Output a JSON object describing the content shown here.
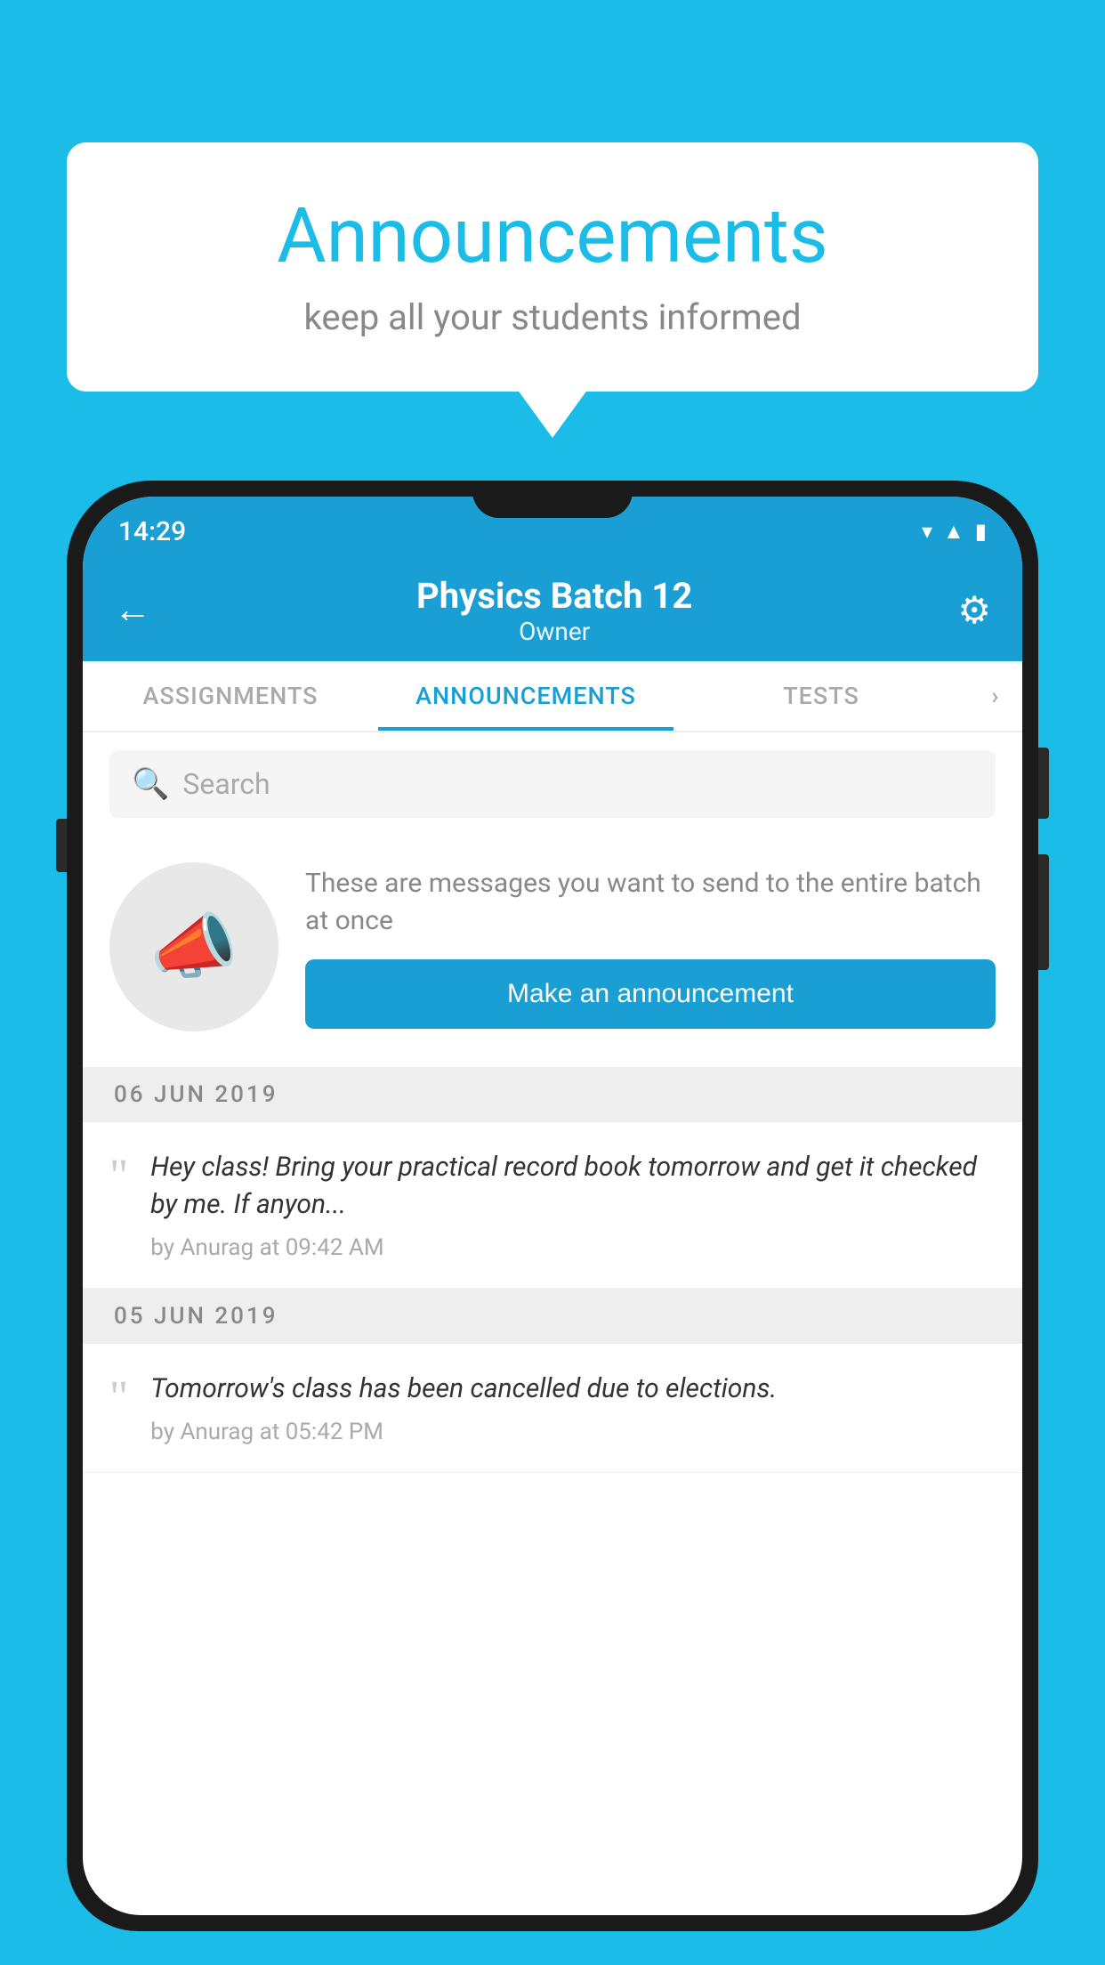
{
  "bubble": {
    "title": "Announcements",
    "subtitle": "keep all your students informed"
  },
  "phone": {
    "status_bar": {
      "time": "14:29"
    },
    "header": {
      "title": "Physics Batch 12",
      "subtitle": "Owner",
      "back_label": "←",
      "gear_label": "⚙"
    },
    "tabs": [
      {
        "label": "ASSIGNMENTS",
        "active": false
      },
      {
        "label": "ANNOUNCEMENTS",
        "active": true
      },
      {
        "label": "TESTS",
        "active": false
      },
      {
        "label": "·",
        "active": false
      }
    ],
    "search": {
      "placeholder": "Search"
    },
    "promo": {
      "description": "These are messages you want to send to the entire batch at once",
      "button_label": "Make an announcement"
    },
    "announcements": [
      {
        "date": "06  JUN  2019",
        "text": "Hey class! Bring your practical record book tomorrow and get it checked by me. If anyon...",
        "meta": "by Anurag at 09:42 AM"
      },
      {
        "date": "05  JUN  2019",
        "text": "Tomorrow's class has been cancelled due to elections.",
        "meta": "by Anurag at 05:42 PM"
      }
    ]
  },
  "colors": {
    "primary": "#1a9fd4",
    "background": "#1bbde8",
    "white": "#ffffff"
  }
}
